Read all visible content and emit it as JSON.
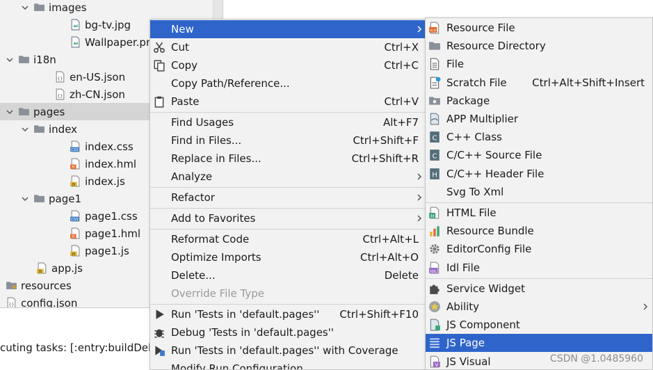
{
  "tree": {
    "rows": [
      {
        "label": "images",
        "icon": "folder-icon",
        "chevron": "down"
      },
      {
        "label": "bg-tv.jpg",
        "icon": "image-file-icon",
        "chevron": ""
      },
      {
        "label": "Wallpaper.png",
        "icon": "image-file-icon",
        "chevron": ""
      },
      {
        "label": "i18n",
        "icon": "folder-icon",
        "chevron": "down"
      },
      {
        "label": "en-US.json",
        "icon": "json-file-icon",
        "chevron": ""
      },
      {
        "label": "zh-CN.json",
        "icon": "json-file-icon",
        "chevron": ""
      },
      {
        "label": "pages",
        "icon": "folder-icon",
        "chevron": "down",
        "selected": true
      },
      {
        "label": "index",
        "icon": "folder-icon",
        "chevron": "down"
      },
      {
        "label": "index.css",
        "icon": "css-file-icon",
        "chevron": ""
      },
      {
        "label": "index.hml",
        "icon": "hml-file-icon",
        "chevron": ""
      },
      {
        "label": "index.js",
        "icon": "js-file-icon",
        "chevron": ""
      },
      {
        "label": "page1",
        "icon": "folder-icon",
        "chevron": "down"
      },
      {
        "label": "page1.css",
        "icon": "css-file-icon",
        "chevron": ""
      },
      {
        "label": "page1.hml",
        "icon": "hml-file-icon",
        "chevron": ""
      },
      {
        "label": "page1.js",
        "icon": "js-file-icon",
        "chevron": ""
      },
      {
        "label": "app.js",
        "icon": "js-file-icon",
        "chevron": ""
      },
      {
        "label": "resources",
        "icon": "resources-folder-icon",
        "chevron": ""
      },
      {
        "label": "config.json",
        "icon": "json-file-icon",
        "chevron": ""
      }
    ]
  },
  "console": {
    "text": "cuting tasks: [:entry:buildDebu"
  },
  "context_menu": {
    "items": [
      {
        "label": "New",
        "shortcut": "",
        "icon": "",
        "submenu": true,
        "active": true
      },
      {
        "label": "Cut",
        "shortcut": "Ctrl+X",
        "icon": "scissors-icon"
      },
      {
        "label": "Copy",
        "shortcut": "Ctrl+C",
        "icon": "copy-icon"
      },
      {
        "label": "Copy Path/Reference...",
        "shortcut": "",
        "icon": ""
      },
      {
        "label": "Paste",
        "shortcut": "Ctrl+V",
        "icon": "clipboard-icon"
      },
      {
        "sep": true
      },
      {
        "label": "Find Usages",
        "shortcut": "Alt+F7",
        "icon": ""
      },
      {
        "label": "Find in Files...",
        "shortcut": "Ctrl+Shift+F",
        "icon": ""
      },
      {
        "label": "Replace in Files...",
        "shortcut": "Ctrl+Shift+R",
        "icon": ""
      },
      {
        "label": "Analyze",
        "shortcut": "",
        "icon": "",
        "submenu": true
      },
      {
        "sep": true
      },
      {
        "label": "Refactor",
        "shortcut": "",
        "icon": "",
        "submenu": true
      },
      {
        "sep": true
      },
      {
        "label": "Add to Favorites",
        "shortcut": "",
        "icon": "",
        "submenu": true
      },
      {
        "sep": true
      },
      {
        "label": "Reformat Code",
        "shortcut": "Ctrl+Alt+L",
        "icon": ""
      },
      {
        "label": "Optimize Imports",
        "shortcut": "Ctrl+Alt+O",
        "icon": ""
      },
      {
        "label": "Delete...",
        "shortcut": "Delete",
        "icon": ""
      },
      {
        "label": "Override File Type",
        "shortcut": "",
        "icon": "",
        "disabled": true
      },
      {
        "sep": true
      },
      {
        "label": "Run 'Tests in 'default.pages''",
        "shortcut": "Ctrl+Shift+F10",
        "icon": "run-icon"
      },
      {
        "label": "Debug 'Tests in 'default.pages''",
        "shortcut": "",
        "icon": "debug-icon"
      },
      {
        "label": "Run 'Tests in 'default.pages'' with Coverage",
        "shortcut": "",
        "icon": "coverage-icon"
      },
      {
        "label": "Modify Run Configuration...",
        "shortcut": "",
        "icon": ""
      }
    ]
  },
  "new_submenu": {
    "items": [
      {
        "label": "Resource File",
        "shortcut": "",
        "icon": "resource-file-icon"
      },
      {
        "label": "Resource Directory",
        "shortcut": "",
        "icon": "folder-icon"
      },
      {
        "label": "File",
        "shortcut": "",
        "icon": "file-icon"
      },
      {
        "label": "Scratch File",
        "shortcut": "Ctrl+Alt+Shift+Insert",
        "icon": "scratch-file-icon"
      },
      {
        "label": "Package",
        "shortcut": "",
        "icon": "package-icon"
      },
      {
        "label": "APP Multiplier",
        "shortcut": "",
        "icon": "app-multiplier-icon"
      },
      {
        "label": "C++ Class",
        "shortcut": "",
        "icon": "cpp-class-icon"
      },
      {
        "label": "C/C++ Source File",
        "shortcut": "",
        "icon": "c-source-icon"
      },
      {
        "label": "C/C++ Header File",
        "shortcut": "",
        "icon": "c-header-icon"
      },
      {
        "label": "Svg To Xml",
        "shortcut": "",
        "icon": ""
      },
      {
        "sep": true
      },
      {
        "label": "HTML File",
        "shortcut": "",
        "icon": "html-file-icon"
      },
      {
        "label": "Resource Bundle",
        "shortcut": "",
        "icon": "resource-bundle-icon"
      },
      {
        "label": "EditorConfig File",
        "shortcut": "",
        "icon": "gear-icon"
      },
      {
        "label": "Idl File",
        "shortcut": "",
        "icon": "idl-file-icon"
      },
      {
        "sep": true
      },
      {
        "label": "Service Widget",
        "shortcut": "",
        "icon": "puzzle-icon"
      },
      {
        "label": "Ability",
        "shortcut": "",
        "icon": "ability-icon",
        "submenu": true
      },
      {
        "label": "JS Component",
        "shortcut": "",
        "icon": "js-component-icon"
      },
      {
        "label": "JS Page",
        "shortcut": "",
        "icon": "js-page-icon",
        "active": true
      },
      {
        "label": "JS Visual",
        "shortcut": "",
        "icon": "js-visual-icon"
      }
    ]
  },
  "watermark": "CSDN @1.0485960",
  "colors": {
    "selection": "#2f65ca",
    "menu_bg": "#f2f2f2",
    "tree_bg": "#f2f2f2",
    "tree_selected": "#d5d5d5"
  }
}
